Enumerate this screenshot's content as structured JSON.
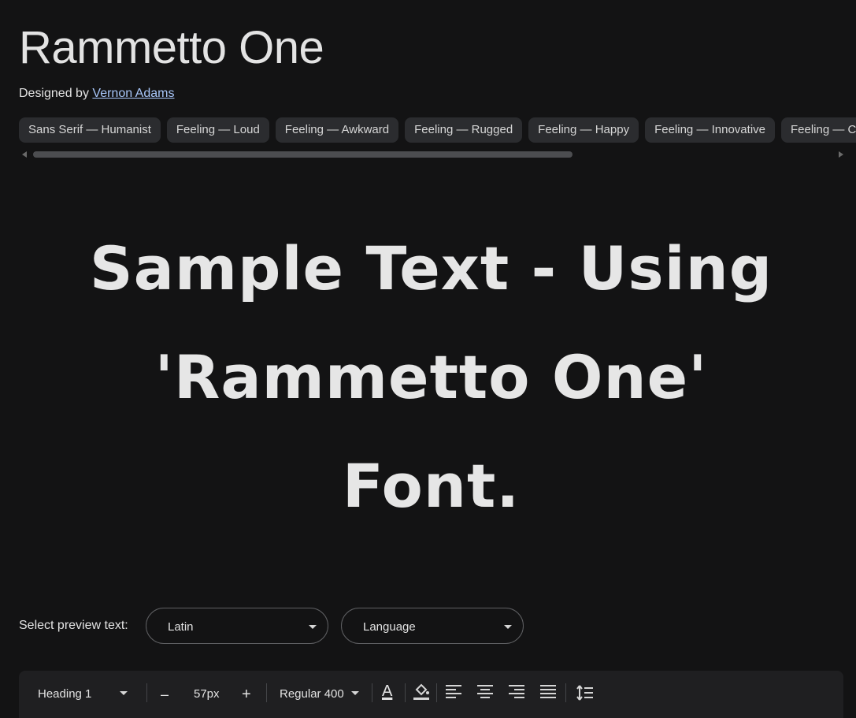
{
  "header": {
    "title": "Rammetto One",
    "designed_by_label": "Designed by",
    "designer": "Vernon Adams"
  },
  "tags": [
    "Sans Serif — Humanist",
    "Feeling — Loud",
    "Feeling — Awkward",
    "Feeling — Rugged",
    "Feeling — Happy",
    "Feeling — Innovative",
    "Feeling — Cute"
  ],
  "preview": {
    "line1": "Sample Text - Using",
    "line2": "'Rammetto One'",
    "line3": "Font."
  },
  "controls": {
    "select_label": "Select preview text:",
    "script_select": "Latin",
    "language_select": "Language"
  },
  "toolbar": {
    "style_select": "Heading 1",
    "decrease": "–",
    "size": "57px",
    "increase": "+",
    "weight_select": "Regular 400",
    "text_color_letter": "A"
  },
  "colors": {
    "background": "#131314",
    "chip_bg": "#2b2c2f",
    "link": "#a8c7fa",
    "text": "#e3e3e3"
  }
}
